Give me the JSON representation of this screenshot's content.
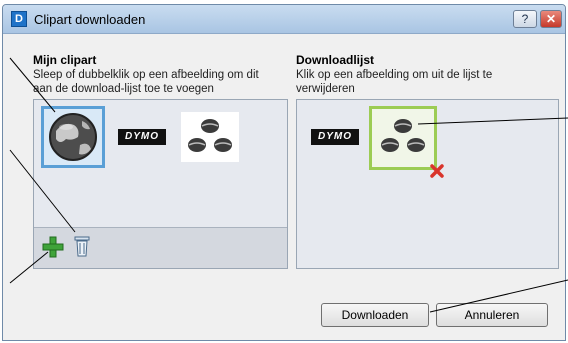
{
  "window": {
    "title": "Clipart downloaden",
    "help_label": "?",
    "close_label": "✕"
  },
  "left": {
    "title": "Mijn clipart",
    "desc_line1": "Sleep of dubbelklik op een afbeelding om dit",
    "desc_line2": "aan de download-lijst toe te voegen",
    "items": [
      "globe-icon",
      "dymo-logo",
      "coffee-beans-icon"
    ],
    "dymo_text": "DYMO"
  },
  "right": {
    "title": "Downloadlijst",
    "desc_line1": "Klik op een afbeelding om uit de lijst te",
    "desc_line2": "verwijderen",
    "dymo_text": "DYMO"
  },
  "buttons": {
    "download": "Downloaden",
    "cancel": "Annuleren"
  },
  "colors": {
    "selected_border": "#5a9fd6",
    "queued_border": "#9ccc54",
    "remove_x": "#d9342b",
    "add_plus": "#3fa33a"
  }
}
